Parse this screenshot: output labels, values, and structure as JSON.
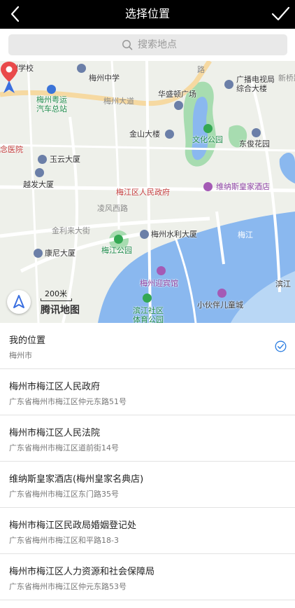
{
  "header": {
    "title": "选择位置",
    "back_icon": "chevron-left-icon",
    "confirm_icon": "checkmark-icon",
    "background": "#000000"
  },
  "search": {
    "placeholder": "搜索地点",
    "icon": "search-icon"
  },
  "map": {
    "labels": {
      "wuzhou_school": "五洲学校",
      "meizhou_middle": "梅州中学",
      "tv_building": "广播电视局\n综合大楼",
      "gdyg_bus": "梅州粤运\n汽车总站",
      "meizhou_ave": "梅州大道",
      "huasheng_plaza": "华盛顿广场",
      "jinshan_building": "金山大楼",
      "culture_park": "文化公园",
      "dongjun_garden": "东俊花园",
      "hospital": "念医院",
      "yuyun_building": "玉云大厦",
      "yuefa_building": "越发大厦",
      "gov_poi": "梅江区人民政府",
      "venice_hotel": "维纳斯皇家酒店",
      "lingfeng_road": "凌风西路",
      "jinli_ave": "金利来大街",
      "kangni_building": "康尼大厦",
      "shuili_building": "梅州水利大厦",
      "meijiang_park": "梅江公园",
      "meijiang_river": "梅江",
      "guest_house": "梅州迎宾馆",
      "binjiang_sports": "滨江社区\n体育公园",
      "kids_town": "小伙伴儿童城",
      "binjiang_right": "滨江",
      "xinqiao": "新桥路",
      "lubei": "路"
    },
    "scale_text": "200米",
    "watermark": "腾讯地图",
    "locate_icon": "navigation-arrow-icon",
    "pin_icon": "map-pin-icon",
    "colors": {
      "water": "#8ab8ef",
      "park": "#a7dcb0",
      "road_major": "#ffffff",
      "road_highlight": "#f6d9a1",
      "land": "#eef0ea",
      "pin_red": "#e94a4a",
      "nav_blue": "#3a6fe0"
    }
  },
  "list": {
    "items": [
      {
        "name": "我的位置",
        "address": "梅州市",
        "selected": true
      },
      {
        "name": "梅州市梅江区人民政府",
        "address": "广东省梅州市梅江区仲元东路51号",
        "selected": false
      },
      {
        "name": "梅州市梅江区人民法院",
        "address": "广东省梅州市梅江区道前街14号",
        "selected": false
      },
      {
        "name": "维纳斯皇家酒店(梅州皇家名典店)",
        "address": "广东省梅州市梅江区东门路35号",
        "selected": false
      },
      {
        "name": "梅州市梅江区民政局婚姻登记处",
        "address": "广东省梅州市梅江区和平路18-3",
        "selected": false
      },
      {
        "name": "梅州市梅江区人力资源和社会保障局",
        "address": "广东省梅州市梅江区仲元东路53号",
        "selected": false
      }
    ],
    "check_icon": "circle-check-icon",
    "accent": "#2b7de1"
  }
}
